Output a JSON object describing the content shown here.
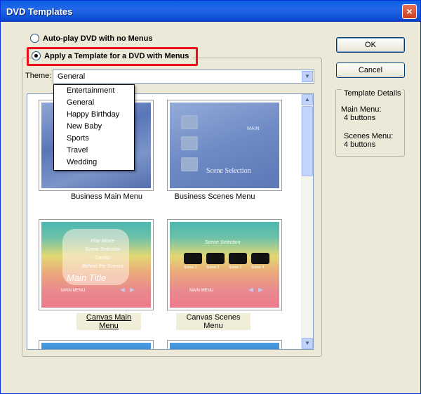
{
  "window": {
    "title": "DVD Templates",
    "close_glyph": "×"
  },
  "options": {
    "autoplay_label": "Auto-play DVD with no Menus",
    "template_label": "Apply a Template for a DVD with Menus"
  },
  "theme": {
    "label": "Theme:",
    "selected": "General",
    "options": [
      "Entertainment",
      "General",
      "Happy Birthday",
      "New Baby",
      "Sports",
      "Travel",
      "Wedding"
    ]
  },
  "templates": [
    {
      "caption": "Business Main Menu"
    },
    {
      "caption": "Business Scenes Menu"
    },
    {
      "caption": "Canvas Main Menu"
    },
    {
      "caption": "Canvas Scenes Menu"
    }
  ],
  "canvas_main": {
    "items": [
      "Play Movie",
      "Scene Selection",
      "Credits",
      "Behind the Scenes"
    ],
    "title": "Main Title",
    "nav": "MAIN MENU"
  },
  "canvas_scenes": {
    "title": "Scene Selection",
    "scenes": [
      "Scene 1",
      "Scene 2",
      "Scene 3",
      "Scene 4"
    ],
    "nav": "MAIN MENU"
  },
  "business_scenes": {
    "title": "Scene Selection",
    "nav": "MAIN"
  },
  "buttons": {
    "ok": "OK",
    "cancel": "Cancel"
  },
  "details": {
    "title": "Template Details",
    "main_menu_label": "Main Menu:",
    "main_menu_value": "4 buttons",
    "scenes_menu_label": "Scenes Menu:",
    "scenes_menu_value": "4 buttons"
  },
  "colors": {
    "titlebar": "#0a5fe4",
    "highlight": "#e8111b",
    "window_bg": "#ece9d8"
  }
}
